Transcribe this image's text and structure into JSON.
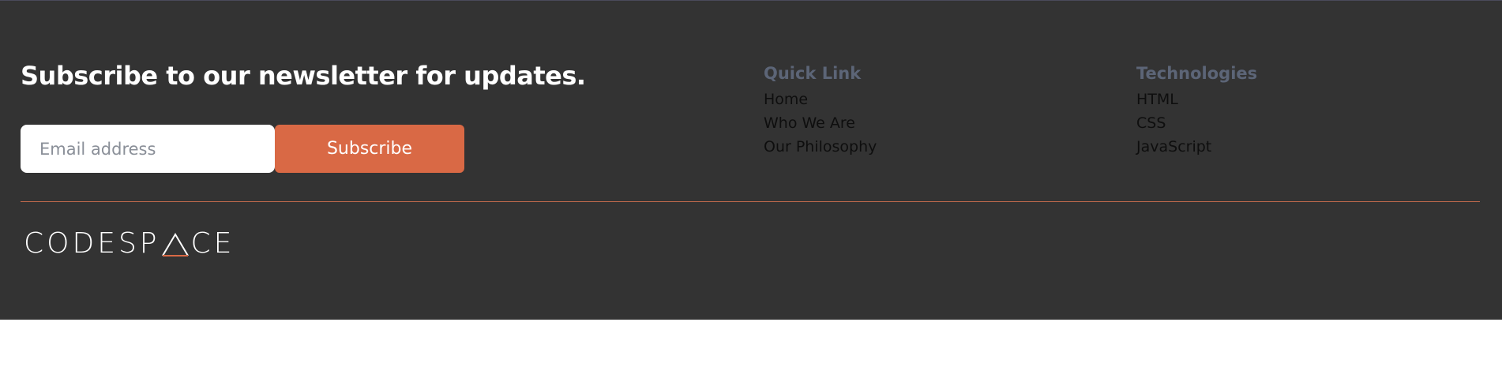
{
  "newsletter": {
    "title": "Subscribe to our newsletter for updates.",
    "email_placeholder": "Email address",
    "subscribe_label": "Subscribe"
  },
  "quick_links": {
    "heading": "Quick Link",
    "items": [
      "Home",
      "Who We Are",
      "Our Philosophy"
    ]
  },
  "technologies": {
    "heading": "Technologies",
    "items": [
      "HTML",
      "CSS",
      "JavaScript"
    ]
  },
  "logo": {
    "part1": "CODESP",
    "part2": "CE",
    "text": "CODESPACE"
  },
  "colors": {
    "footer_bg": "#333333",
    "accent": "#d96945",
    "heading": "#5c6577"
  }
}
